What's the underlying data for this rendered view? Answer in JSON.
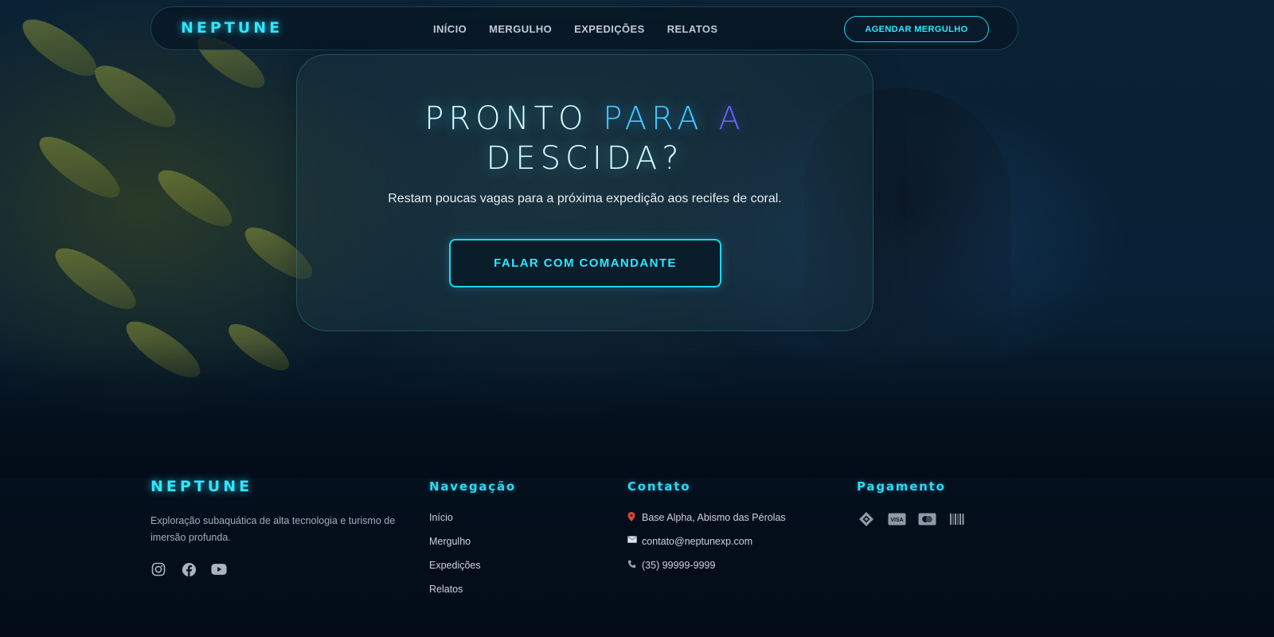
{
  "brand": "NEPTUNE",
  "nav": {
    "links": [
      "INÍCIO",
      "MERGULHO",
      "EXPEDIÇÕES",
      "RELATOS"
    ],
    "cta": "AGENDAR MERGULHO"
  },
  "hero": {
    "title_part1": "PRONTO ",
    "title_part2": "PARA ",
    "title_part3": "A",
    "title_line2": "DESCIDA?",
    "subtitle": "Restam poucas vagas para a próxima expedição aos recifes de coral.",
    "cta": "FALAR COM COMANDANTE"
  },
  "footer": {
    "brand": "NEPTUNE",
    "description": "Exploração subaquática de alta tecnologia e turismo de imersão profunda.",
    "socials": [
      "instagram-icon",
      "facebook-icon",
      "youtube-icon"
    ],
    "nav_heading": "Navegação",
    "nav_links": [
      "Início",
      "Mergulho",
      "Expedições",
      "Relatos"
    ],
    "contact_heading": "Contato",
    "contact": {
      "address": "Base Alpha, Abismo das Pérolas",
      "email": "contato@neptunexp.com",
      "phone": "(35) 99999-9999"
    },
    "payment_heading": "Pagamento",
    "payment_icons": [
      "pix-icon",
      "visa-icon",
      "mastercard-icon",
      "barcode-icon"
    ]
  },
  "colors": {
    "accent": "#2fe6ff",
    "accent_violet": "#6a63ff",
    "background": "#030c18"
  }
}
